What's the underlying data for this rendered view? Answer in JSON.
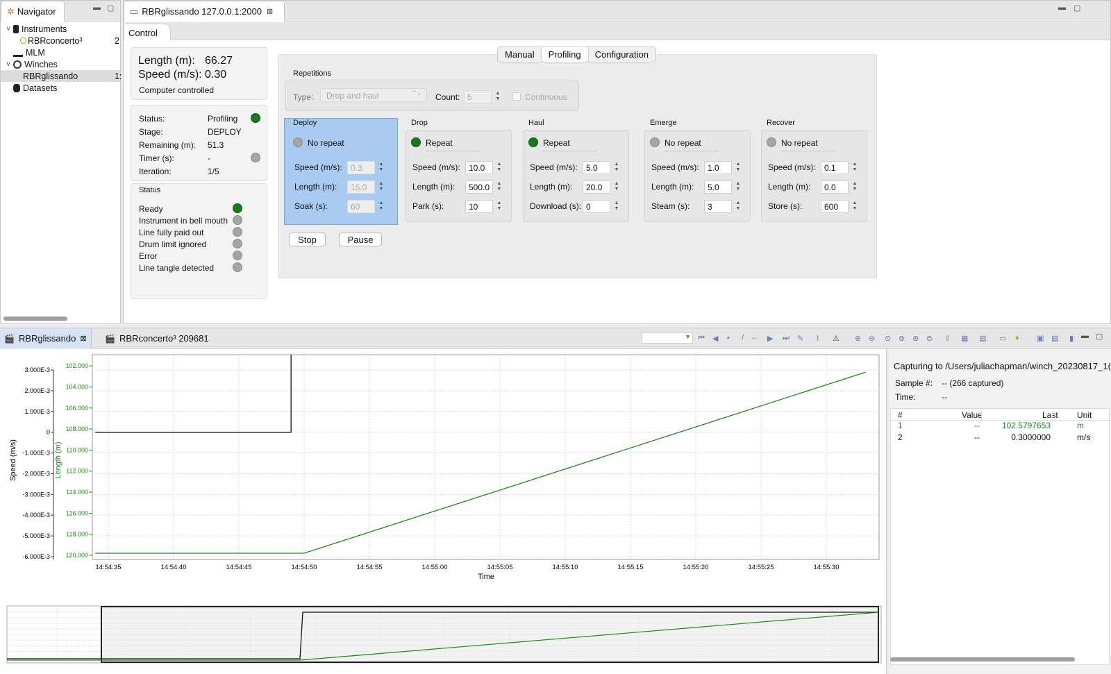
{
  "navigator": {
    "tab_label": "Navigator",
    "tree": [
      {
        "label": "Instruments",
        "expander": "v",
        "indent": 0,
        "icon": "instrument-icon"
      },
      {
        "label": "RBRconcerto³",
        "expander": "",
        "indent": 1,
        "icon": "status-dot-icon",
        "suffix": "2"
      },
      {
        "label": "MLM",
        "expander": "",
        "indent": 0,
        "icon": "mlm-icon"
      },
      {
        "label": "Winches",
        "expander": "v",
        "indent": 0,
        "icon": "winch-icon"
      },
      {
        "label": "RBRglissando",
        "expander": "",
        "indent": 1,
        "icon": "",
        "suffix": "1:",
        "selected": true
      },
      {
        "label": "Datasets",
        "expander": "",
        "indent": 0,
        "icon": "database-icon"
      }
    ]
  },
  "editor": {
    "tab_label": "RBRglissando 127.0.0.1:2000",
    "sub_tab": "Control"
  },
  "readout": {
    "length_label": "Length (m):",
    "length_value": "66.27",
    "speed_label": "Speed (m/s):",
    "speed_value": "0.30",
    "mode": "Computer controlled"
  },
  "status_box": {
    "status_label": "Status:",
    "status_value": "Profiling",
    "stage_label": "Stage:",
    "stage_value": "DEPLOY",
    "remaining_label": "Remaining (m):",
    "remaining_value": "51.3",
    "timer_label": "Timer (s):",
    "timer_value": "-",
    "iteration_label": "Iteration:",
    "iteration_value": "1/5"
  },
  "indicators": {
    "title": "Status",
    "items": [
      {
        "label": "Ready",
        "state": "green"
      },
      {
        "label": "Instrument in bell mouth",
        "state": "gray"
      },
      {
        "label": "Line fully paid out",
        "state": "gray"
      },
      {
        "label": "Drum limit ignored",
        "state": "gray"
      },
      {
        "label": "Error",
        "state": "gray"
      },
      {
        "label": "Line tangle detected",
        "state": "gray"
      }
    ]
  },
  "mode_tabs": [
    "Manual",
    "Profiling",
    "Configuration"
  ],
  "repetitions": {
    "title": "Repetitions",
    "type_label": "Type:",
    "type_value": "Drop and haul",
    "count_label": "Count:",
    "count_value": "5",
    "continuous_label": "Continuous"
  },
  "stages": [
    {
      "title": "Deploy",
      "repeat_label": "No repeat",
      "repeat": false,
      "highlight": true,
      "rows": [
        {
          "label": "Speed (m/s):",
          "value": "0.3",
          "disabled": true
        },
        {
          "label": "Length (m):",
          "value": "15.0",
          "disabled": true
        },
        {
          "label": "Soak (s):",
          "value": "60",
          "disabled": true
        }
      ]
    },
    {
      "title": "Drop",
      "repeat_label": "Repeat",
      "repeat": true,
      "rows": [
        {
          "label": "Speed (m/s):",
          "value": "10.0"
        },
        {
          "label": "Length (m):",
          "value": "500.0"
        },
        {
          "label": "Park (s):",
          "value": "10"
        }
      ]
    },
    {
      "title": "Haul",
      "repeat_label": "Repeat",
      "repeat": true,
      "rows": [
        {
          "label": "Speed (m/s):",
          "value": "5.0"
        },
        {
          "label": "Length (m):",
          "value": "20.0"
        },
        {
          "label": "Download (s):",
          "value": "0"
        }
      ]
    },
    {
      "title": "Emerge",
      "repeat_label": "No repeat",
      "repeat": false,
      "rows": [
        {
          "label": "Speed (m/s):",
          "value": "1.0"
        },
        {
          "label": "Length (m):",
          "value": "5.0"
        },
        {
          "label": "Steam (s):",
          "value": "3"
        }
      ]
    },
    {
      "title": "Recover",
      "repeat_label": "No repeat",
      "repeat": false,
      "rows": [
        {
          "label": "Speed (m/s):",
          "value": "0.1"
        },
        {
          "label": "Length (m):",
          "value": "0.0"
        },
        {
          "label": "Store (s):",
          "value": "600"
        }
      ]
    }
  ],
  "buttons": {
    "stop": "Stop",
    "pause": "Pause"
  },
  "bottom_tabs": [
    {
      "label": "RBRglissando",
      "active": true,
      "closable": true
    },
    {
      "label": "RBRconcerto³ 209681",
      "active": false,
      "closable": false
    }
  ],
  "capture": {
    "title": "Capturing to /Users/juliachapman/winch_20230817_1(",
    "sample_label": "Sample #:",
    "sample_value": "-- (266 captured)",
    "time_label": "Time:",
    "time_value": "--",
    "columns": [
      "#",
      "Value",
      "Last",
      "Unit"
    ],
    "rows": [
      {
        "n": "1",
        "value": "--",
        "last": "102.5797653",
        "unit": "m",
        "color": "#1a8a1a"
      },
      {
        "n": "2",
        "value": "--",
        "last": "0.3000000",
        "unit": "m/s",
        "color": "#111111"
      }
    ]
  },
  "chart_data": {
    "type": "line",
    "xlabel": "Time",
    "x_ticks": [
      "14:54:35",
      "14:54:40",
      "14:54:45",
      "14:54:50",
      "14:54:55",
      "14:55:00",
      "14:55:05",
      "14:55:10",
      "14:55:15",
      "14:55:20",
      "14:55:25",
      "14:55:30"
    ],
    "y_left": {
      "label": "Speed (m/s)",
      "ticks": [
        "3.000E-3",
        "2.000E-3",
        "1.000E-3",
        "0",
        "-1.000E-3",
        "-2.000E-3",
        "-3.000E-3",
        "-4.000E-3",
        "-5.000E-3",
        "-6.000E-3"
      ],
      "range": [
        -0.006,
        0.003
      ]
    },
    "y_right": {
      "label": "Length (m)",
      "ticks": [
        "102.000",
        "104.000",
        "106.000",
        "108.000",
        "110.000",
        "112.000",
        "114.000",
        "116.000",
        "118.000",
        "120.000"
      ],
      "range": [
        120,
        101.2
      ],
      "inverted": true
    },
    "grid": true,
    "series": [
      {
        "axis": "speed",
        "color": "#111111",
        "points": [
          [
            "14:54:34",
            0.0
          ],
          [
            "14:54:49",
            0.0
          ],
          [
            "14:54:49",
            0.004
          ]
        ]
      },
      {
        "axis": "length",
        "color": "#1a8a1a",
        "points": [
          [
            "14:54:34",
            119.8
          ],
          [
            "14:54:50",
            119.8
          ],
          [
            "14:55:33",
            102.6
          ]
        ]
      }
    ]
  }
}
